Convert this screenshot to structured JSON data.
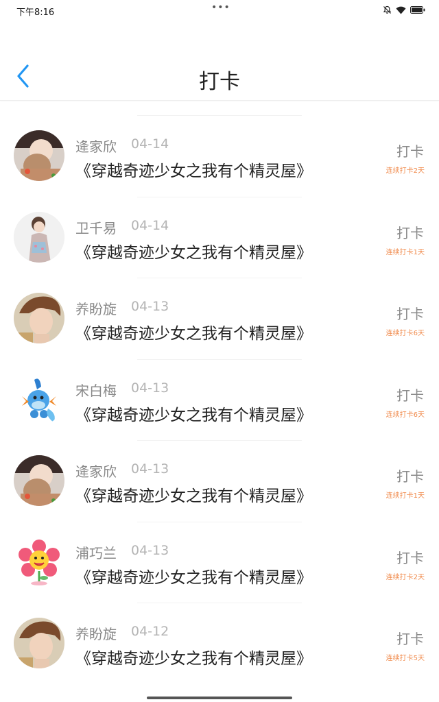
{
  "status_bar": {
    "time": "下午8:16",
    "dots": "•••"
  },
  "header": {
    "title": "打卡"
  },
  "items": [
    {
      "name": "逄家欣",
      "date": "04-14",
      "book": "《穿越奇迹少女之我有个精灵屋》",
      "action": "打卡",
      "streak": "连续打卡2天",
      "avatar": "girl-photo-avatar"
    },
    {
      "name": "卫千易",
      "date": "04-14",
      "book": "《穿越奇迹少女之我有个精灵屋》",
      "action": "打卡",
      "streak": "连续打卡1天",
      "avatar": "woman-photo-avatar"
    },
    {
      "name": "养盼旋",
      "date": "04-13",
      "book": "《穿越奇迹少女之我有个精灵屋》",
      "action": "打卡",
      "streak": "连续打卡6天",
      "avatar": "boy-photo-avatar"
    },
    {
      "name": "宋白梅",
      "date": "04-13",
      "book": "《穿越奇迹少女之我有个精灵屋》",
      "action": "打卡",
      "streak": "连续打卡6天",
      "avatar": "mudkip-avatar"
    },
    {
      "name": "逄家欣",
      "date": "04-13",
      "book": "《穿越奇迹少女之我有个精灵屋》",
      "action": "打卡",
      "streak": "连续打卡1天",
      "avatar": "girl-photo-avatar"
    },
    {
      "name": "浦巧兰",
      "date": "04-13",
      "book": "《穿越奇迹少女之我有个精灵屋》",
      "action": "打卡",
      "streak": "连续打卡2天",
      "avatar": "flower-avatar"
    },
    {
      "name": "养盼旋",
      "date": "04-12",
      "book": "《穿越奇迹少女之我有个精灵屋》",
      "action": "打卡",
      "streak": "连续打卡5天",
      "avatar": "boy-photo-avatar"
    }
  ],
  "colors": {
    "accent": "#2196f3",
    "streak": "#f08a4b"
  }
}
